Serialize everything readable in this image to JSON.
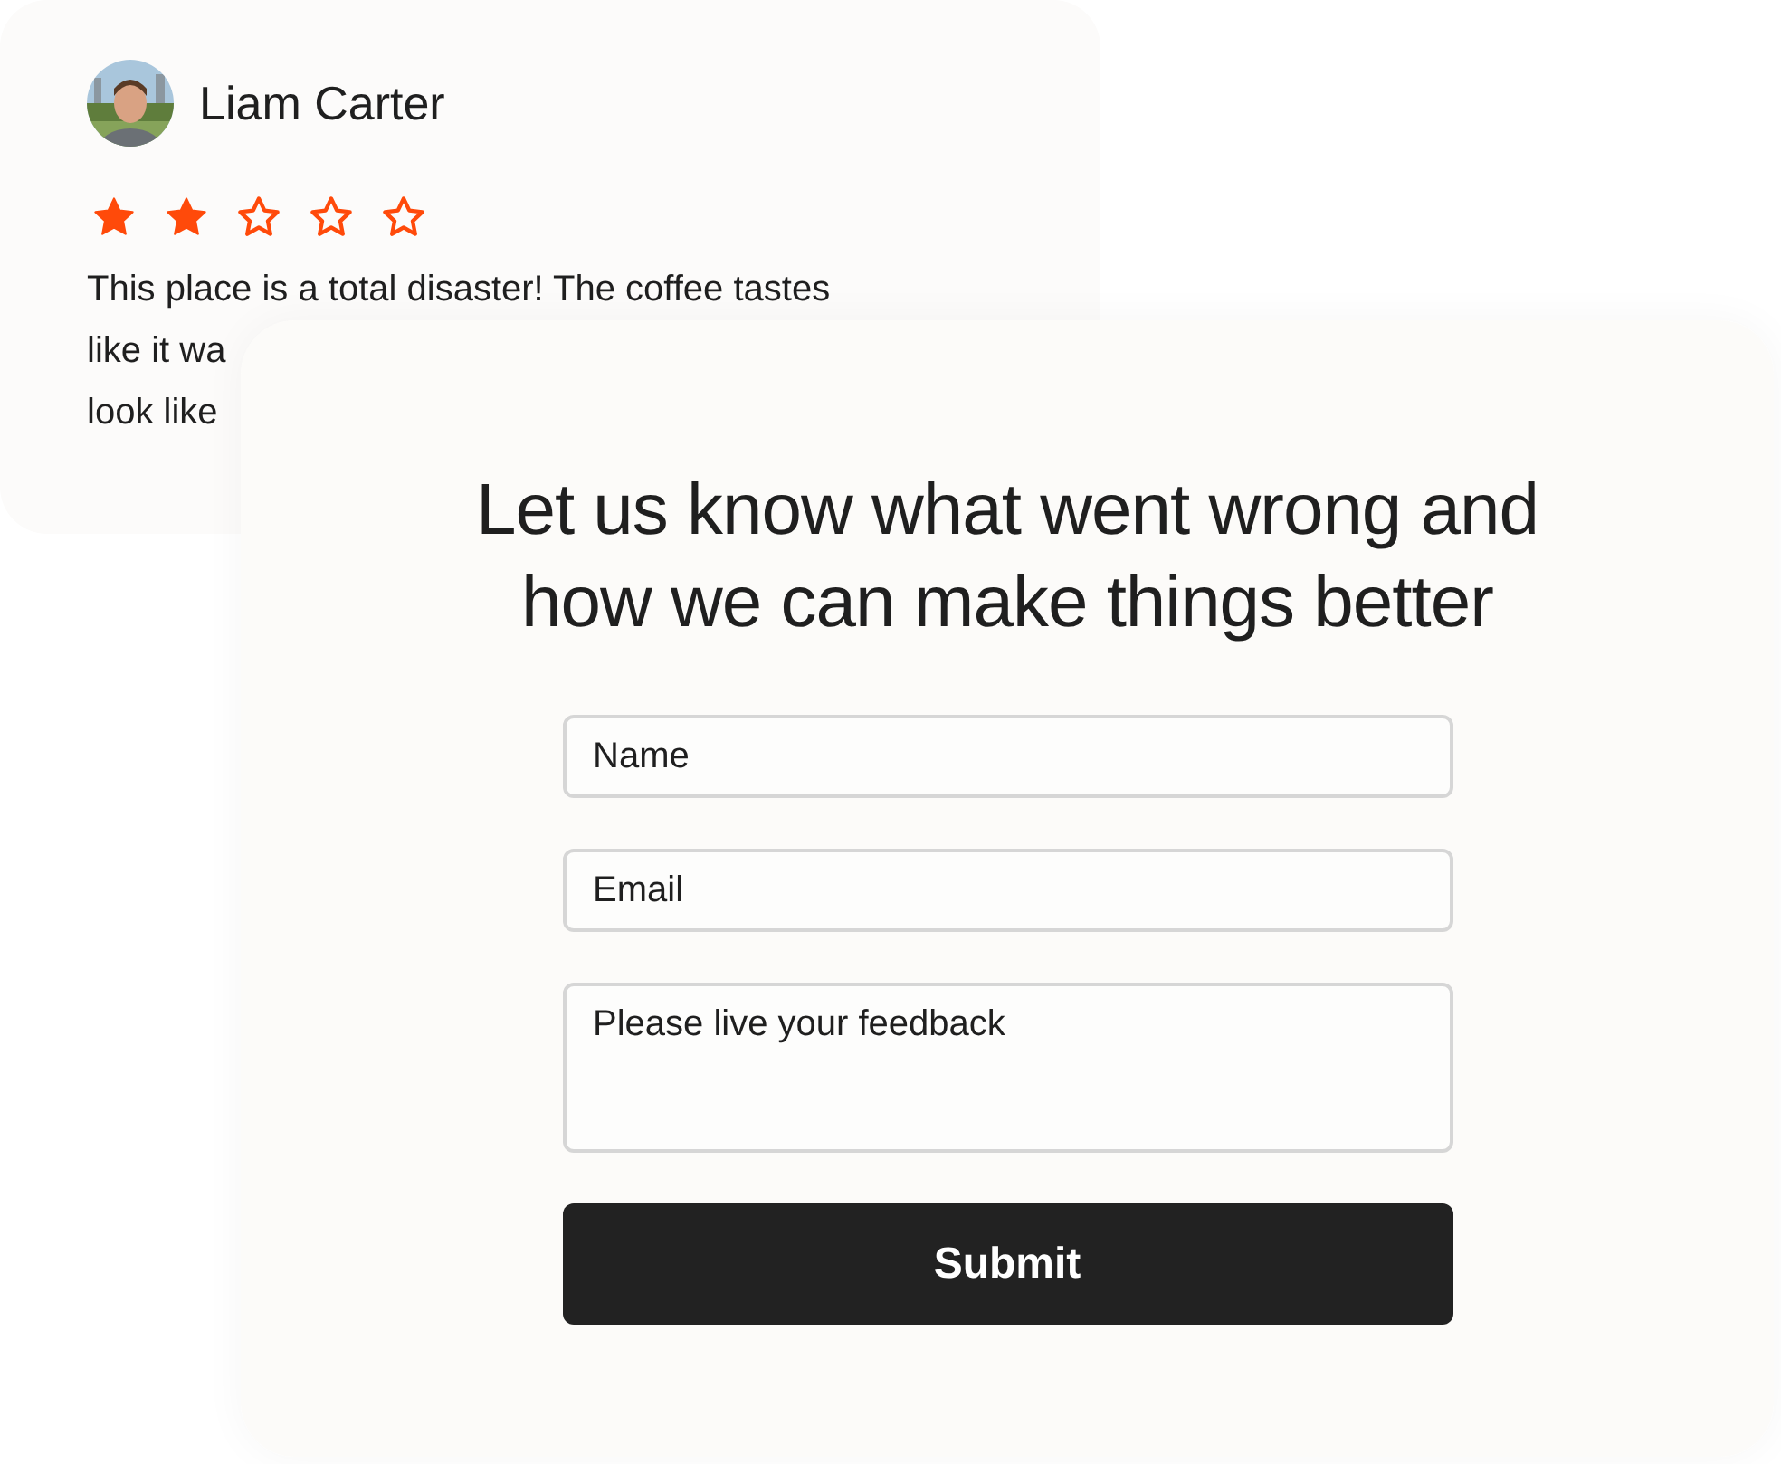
{
  "review": {
    "author": "Liam Carter",
    "stars": 2,
    "lines": [
      "This place is a total disaster! The coffee tastes",
      "like it wa",
      "look like"
    ]
  },
  "form": {
    "title": "Let us know what went wrong and how we can make things better",
    "fields": [
      {
        "kind": "input",
        "placeholder": "Name"
      },
      {
        "kind": "input",
        "placeholder": "Email"
      },
      {
        "kind": "textarea",
        "placeholder": "Please live your feedback"
      }
    ],
    "submit": "Submit"
  }
}
